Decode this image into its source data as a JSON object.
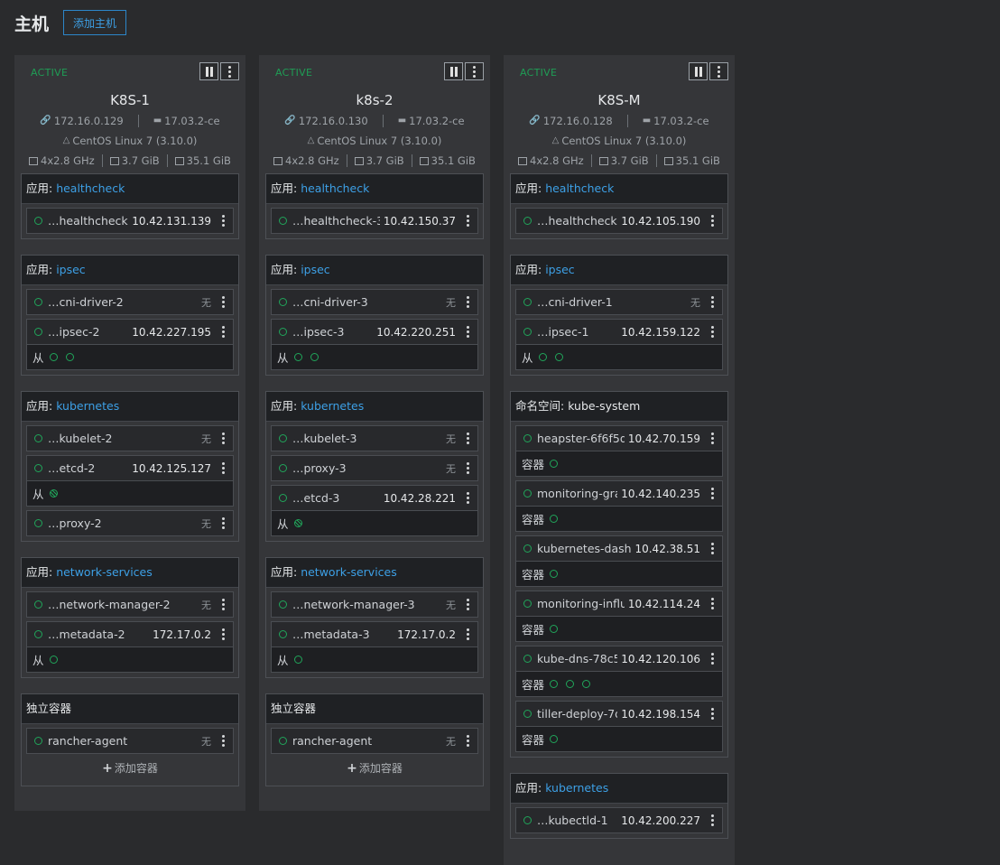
{
  "page": {
    "title": "主机",
    "add_host_label": "添加主机"
  },
  "labels": {
    "app_prefix": "应用: ",
    "namespace_prefix": "命名空间: ",
    "sidekick": "从",
    "container": "容器",
    "none": "无",
    "add_container": "添加容器"
  },
  "colors": {
    "background": "#2a2b2d",
    "card": "#353639",
    "active": "#1f9d55",
    "link": "#3da0e6",
    "status_ring": "#20a55a"
  },
  "hosts": [
    {
      "state": "ACTIVE",
      "name": "K8S-1",
      "ip": "172.16.0.129",
      "docker": "17.03.2-ce",
      "os": "CentOS Linux 7 (3.10.0)",
      "cpu": "4x2.8 GHz",
      "ram": "3.7 GiB",
      "disk": "35.1 GiB"
    },
    {
      "state": "ACTIVE",
      "name": "k8s-2",
      "ip": "172.16.0.130",
      "docker": "17.03.2-ce",
      "os": "CentOS Linux 7 (3.10.0)",
      "cpu": "4x2.8 GHz",
      "ram": "3.7 GiB",
      "disk": "35.1 GiB"
    },
    {
      "state": "ACTIVE",
      "name": "K8S-M",
      "ip": "172.16.0.128",
      "docker": "17.03.2-ce",
      "os": "CentOS Linux 7 (3.10.0)",
      "cpu": "4x2.8 GHz",
      "ram": "3.7 GiB",
      "disk": "35.1 GiB"
    }
  ],
  "icons": [
    "pause-icon",
    "more-vertical-icon",
    "link-icon",
    "docker-icon",
    "linux-icon",
    "cpu-icon",
    "memory-icon",
    "disk-icon",
    "status-ring-icon",
    "plus-icon"
  ]
}
